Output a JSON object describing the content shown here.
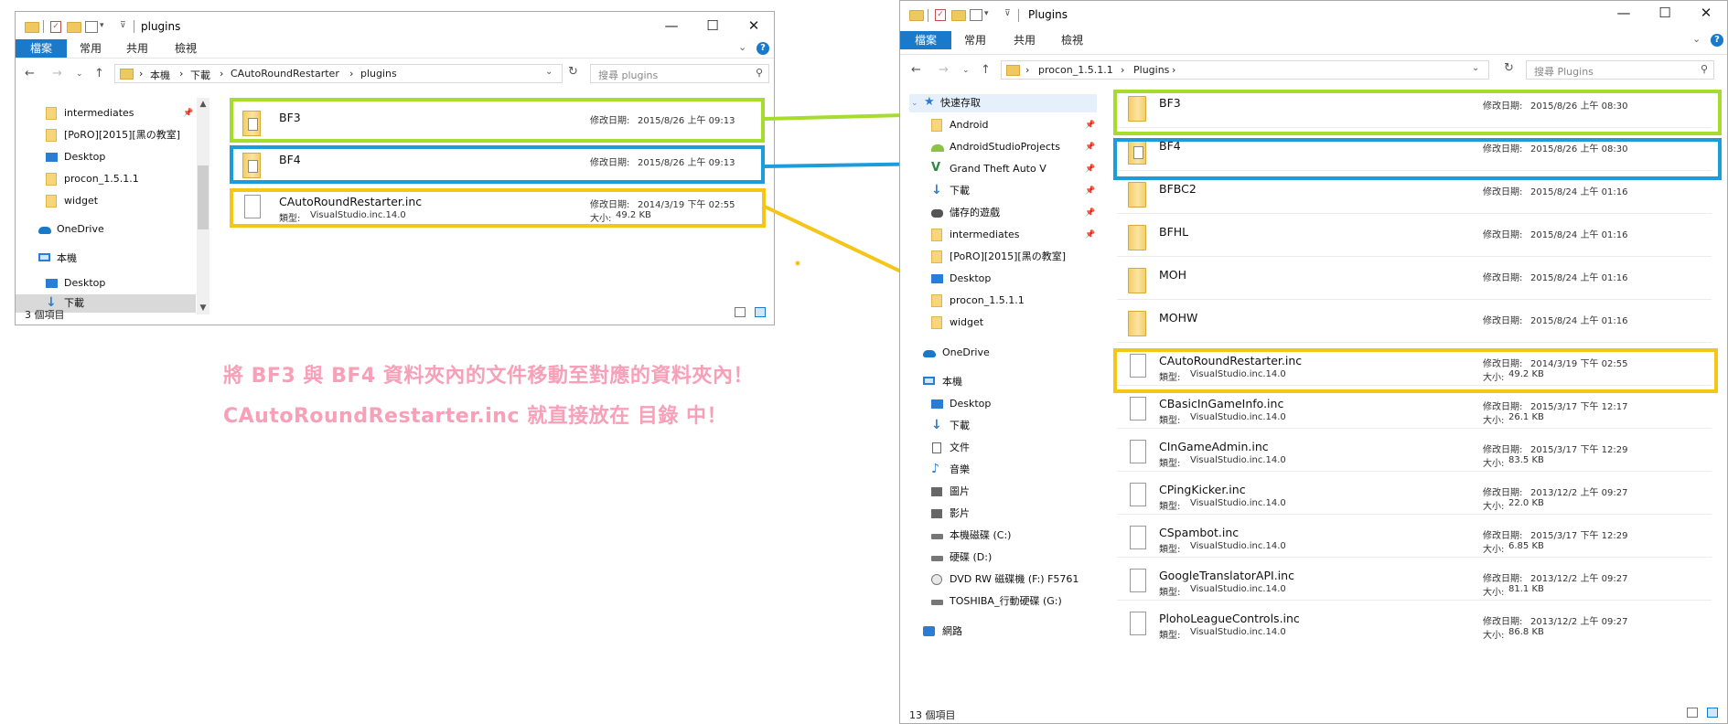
{
  "colors": {
    "highlight_green": "#a6dc2c",
    "highlight_blue": "#1c9cd9",
    "highlight_yellow": "#f5c518",
    "caption_pink": "#f7a0b8",
    "ribbon_file_tab": "#1979ca"
  },
  "captions": {
    "line1": "將 BF3 與 BF4 資料夾內的文件移動至對應的資料夾內！",
    "line2": "CAutoRoundRestarter.inc 就直接放在 目錄 中！"
  },
  "left_window": {
    "title": "plugins",
    "ribbon": {
      "file_tab": "檔案",
      "tabs": [
        "常用",
        "共用",
        "檢視"
      ]
    },
    "address": {
      "crumbs": [
        "本機",
        "下載",
        "CAutoRoundRestarter",
        "plugins"
      ]
    },
    "search_placeholder": "搜尋 plugins",
    "nav": {
      "items": [
        {
          "label": "intermediates",
          "icon": "folder-icon",
          "pinned": true
        },
        {
          "label": "[PoRO][2015][黑の教室]",
          "icon": "folder-icon",
          "pinned": false
        },
        {
          "label": "Desktop",
          "icon": "desktop-icon",
          "pinned": false
        },
        {
          "label": "procon_1.5.1.1",
          "icon": "folder-icon",
          "pinned": false
        },
        {
          "label": "widget",
          "icon": "folder-icon",
          "pinned": false
        },
        {
          "label": "OneDrive",
          "icon": "cloud-icon",
          "pinned": false
        },
        {
          "label": "本機",
          "icon": "pc-icon",
          "pinned": false
        },
        {
          "label": "Desktop",
          "icon": "desktop-icon",
          "pinned": false
        },
        {
          "label": "下載",
          "icon": "download-icon",
          "pinned": false
        }
      ]
    },
    "files": [
      {
        "name": "BF3",
        "modified_label": "修改日期:",
        "modified": "2015/8/26 上午 09:13",
        "type_label": "",
        "type": "",
        "size_label": "",
        "size": "",
        "icon": "folder-with-files-icon"
      },
      {
        "name": "BF4",
        "modified_label": "修改日期:",
        "modified": "2015/8/26 上午 09:13",
        "type_label": "",
        "type": "",
        "size_label": "",
        "size": "",
        "icon": "folder-with-files-icon"
      },
      {
        "name": "CAutoRoundRestarter.inc",
        "modified_label": "修改日期:",
        "modified": "2014/3/19 下午 02:55",
        "type_label": "類型:",
        "type": "VisualStudio.inc.14.0",
        "size_label": "大小:",
        "size": "49.2 KB",
        "icon": "file-icon"
      }
    ],
    "status": "3 個項目"
  },
  "right_window": {
    "title": "Plugins",
    "ribbon": {
      "file_tab": "檔案",
      "tabs": [
        "常用",
        "共用",
        "檢視"
      ]
    },
    "address": {
      "crumbs": [
        "procon_1.5.1.1",
        "Plugins"
      ]
    },
    "search_placeholder": "搜尋 Plugins",
    "nav": {
      "items": [
        {
          "label": "快速存取",
          "icon": "star-icon",
          "pinned": false
        },
        {
          "label": "Android",
          "icon": "folder-icon",
          "pinned": true
        },
        {
          "label": "AndroidStudioProjects",
          "icon": "android-icon",
          "pinned": true
        },
        {
          "label": "Grand Theft Auto V",
          "icon": "gta-icon",
          "pinned": true
        },
        {
          "label": "下載",
          "icon": "download-icon",
          "pinned": true
        },
        {
          "label": "儲存的遊戲",
          "icon": "game-icon",
          "pinned": true
        },
        {
          "label": "intermediates",
          "icon": "folder-icon",
          "pinned": true
        },
        {
          "label": "[PoRO][2015][黑の教室]",
          "icon": "folder-icon",
          "pinned": false
        },
        {
          "label": "Desktop",
          "icon": "desktop-icon",
          "pinned": false
        },
        {
          "label": "procon_1.5.1.1",
          "icon": "folder-icon",
          "pinned": false
        },
        {
          "label": "widget",
          "icon": "folder-icon",
          "pinned": false
        },
        {
          "label": "OneDrive",
          "icon": "cloud-icon",
          "pinned": false
        },
        {
          "label": "本機",
          "icon": "pc-icon",
          "pinned": false
        },
        {
          "label": "Desktop",
          "icon": "desktop-icon",
          "pinned": false
        },
        {
          "label": "下載",
          "icon": "download-icon",
          "pinned": false
        },
        {
          "label": "文件",
          "icon": "document-icon",
          "pinned": false
        },
        {
          "label": "音樂",
          "icon": "music-icon",
          "pinned": false
        },
        {
          "label": "圖片",
          "icon": "picture-icon",
          "pinned": false
        },
        {
          "label": "影片",
          "icon": "video-icon",
          "pinned": false
        },
        {
          "label": "本機磁碟 (C:)",
          "icon": "drive-icon",
          "pinned": false
        },
        {
          "label": "硬碟 (D:)",
          "icon": "drive-icon",
          "pinned": false
        },
        {
          "label": "DVD RW 磁碟機 (F:) F5761",
          "icon": "dvd-icon",
          "pinned": false
        },
        {
          "label": "TOSHIBA_行動硬碟 (G:)",
          "icon": "drive-icon",
          "pinned": false
        },
        {
          "label": "網路",
          "icon": "network-icon",
          "pinned": false
        }
      ]
    },
    "files": [
      {
        "name": "BF3",
        "modified_label": "修改日期:",
        "modified": "2015/8/26 上午 08:30",
        "type_label": "",
        "type": "",
        "size_label": "",
        "size": "",
        "icon": "folder-icon"
      },
      {
        "name": "BF4",
        "modified_label": "修改日期:",
        "modified": "2015/8/26 上午 08:30",
        "type_label": "",
        "type": "",
        "size_label": "",
        "size": "",
        "icon": "folder-with-files-icon"
      },
      {
        "name": "BFBC2",
        "modified_label": "修改日期:",
        "modified": "2015/8/24 上午 01:16",
        "type_label": "",
        "type": "",
        "size_label": "",
        "size": "",
        "icon": "folder-icon"
      },
      {
        "name": "BFHL",
        "modified_label": "修改日期:",
        "modified": "2015/8/24 上午 01:16",
        "type_label": "",
        "type": "",
        "size_label": "",
        "size": "",
        "icon": "folder-icon"
      },
      {
        "name": "MOH",
        "modified_label": "修改日期:",
        "modified": "2015/8/24 上午 01:16",
        "type_label": "",
        "type": "",
        "size_label": "",
        "size": "",
        "icon": "folder-icon"
      },
      {
        "name": "MOHW",
        "modified_label": "修改日期:",
        "modified": "2015/8/24 上午 01:16",
        "type_label": "",
        "type": "",
        "size_label": "",
        "size": "",
        "icon": "folder-icon"
      },
      {
        "name": "CAutoRoundRestarter.inc",
        "modified_label": "修改日期:",
        "modified": "2014/3/19 下午 02:55",
        "type_label": "類型:",
        "type": "VisualStudio.inc.14.0",
        "size_label": "大小:",
        "size": "49.2 KB",
        "icon": "file-icon"
      },
      {
        "name": "CBasicInGameInfo.inc",
        "modified_label": "修改日期:",
        "modified": "2015/3/17 下午 12:17",
        "type_label": "類型:",
        "type": "VisualStudio.inc.14.0",
        "size_label": "大小:",
        "size": "26.1 KB",
        "icon": "file-icon"
      },
      {
        "name": "CInGameAdmin.inc",
        "modified_label": "修改日期:",
        "modified": "2015/3/17 下午 12:29",
        "type_label": "類型:",
        "type": "VisualStudio.inc.14.0",
        "size_label": "大小:",
        "size": "83.5 KB",
        "icon": "file-icon"
      },
      {
        "name": "CPingKicker.inc",
        "modified_label": "修改日期:",
        "modified": "2013/12/2 上午 09:27",
        "type_label": "類型:",
        "type": "VisualStudio.inc.14.0",
        "size_label": "大小:",
        "size": "22.0 KB",
        "icon": "file-icon"
      },
      {
        "name": "CSpambot.inc",
        "modified_label": "修改日期:",
        "modified": "2015/3/17 下午 12:29",
        "type_label": "類型:",
        "type": "VisualStudio.inc.14.0",
        "size_label": "大小:",
        "size": "6.85 KB",
        "icon": "file-icon"
      },
      {
        "name": "GoogleTranslatorAPI.inc",
        "modified_label": "修改日期:",
        "modified": "2013/12/2 上午 09:27",
        "type_label": "類型:",
        "type": "VisualStudio.inc.14.0",
        "size_label": "大小:",
        "size": "81.1 KB",
        "icon": "file-icon"
      },
      {
        "name": "PlohoLeagueControls.inc",
        "modified_label": "修改日期:",
        "modified": "2013/12/2 上午 09:27",
        "type_label": "類型:",
        "type": "VisualStudio.inc.14.0",
        "size_label": "大小:",
        "size": "86.8 KB",
        "icon": "file-icon"
      }
    ],
    "status": "13 個項目"
  }
}
